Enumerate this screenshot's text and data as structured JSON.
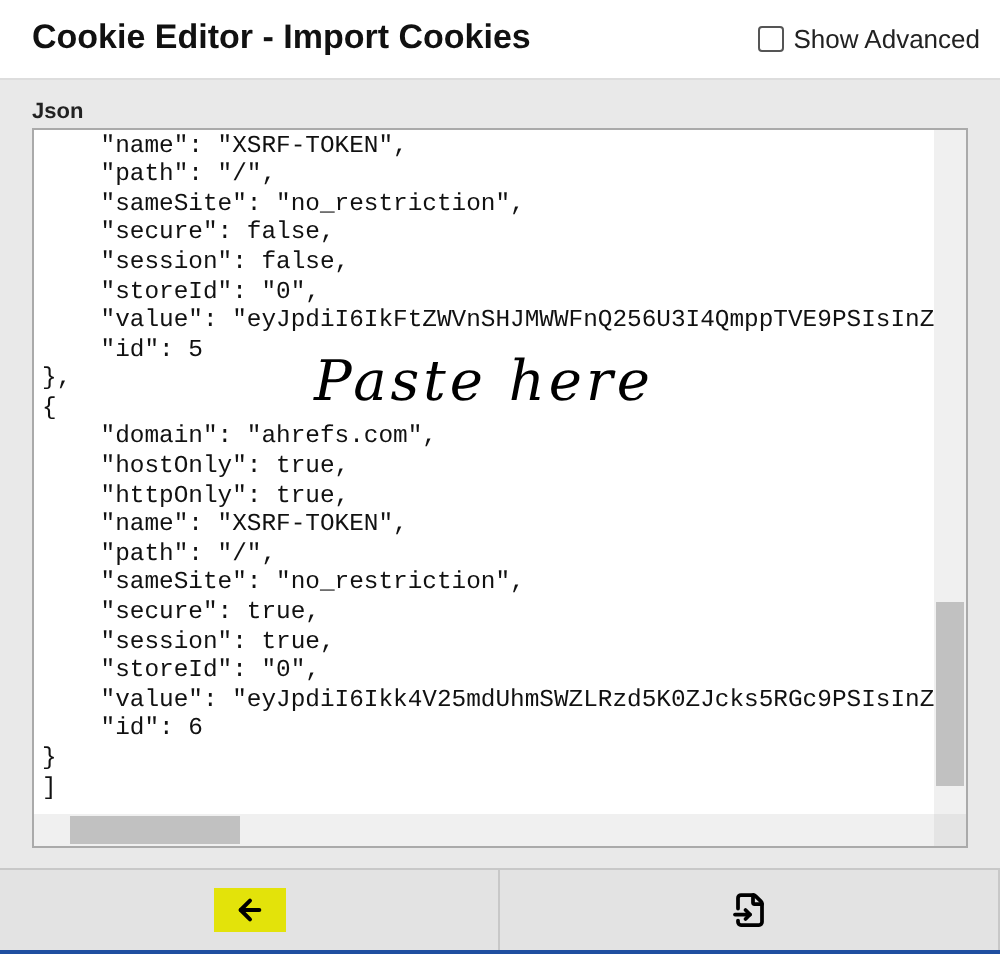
{
  "window": {
    "title": "Cookie Editor - Import Cookies"
  },
  "show_advanced": {
    "label": "Show Advanced",
    "checked": false
  },
  "editor": {
    "label": "Json",
    "lines": [
      "    \"name\": \"XSRF-TOKEN\",",
      "    \"path\": \"/\",",
      "    \"sameSite\": \"no_restriction\",",
      "    \"secure\": false,",
      "    \"session\": false,",
      "    \"storeId\": \"0\",",
      "    \"value\": \"eyJpdiI6IkFtZWVnSHJMWWFnQ256U3I4QmppTVE9PSIsInZ",
      "    \"id\": 5",
      "},",
      "{",
      "    \"domain\": \"ahrefs.com\",",
      "    \"hostOnly\": true,",
      "    \"httpOnly\": true,",
      "    \"name\": \"XSRF-TOKEN\",",
      "    \"path\": \"/\",",
      "    \"sameSite\": \"no_restriction\",",
      "    \"secure\": true,",
      "    \"session\": true,",
      "    \"storeId\": \"0\",",
      "    \"value\": \"eyJpdiI6Ikk4V25mdUhmSWZLRzd5K0ZJcks5RGc9PSIsInZ",
      "    \"id\": 6",
      "}",
      "]"
    ],
    "annotation": "Paste here"
  },
  "footer": {
    "back_highlighted": true
  }
}
